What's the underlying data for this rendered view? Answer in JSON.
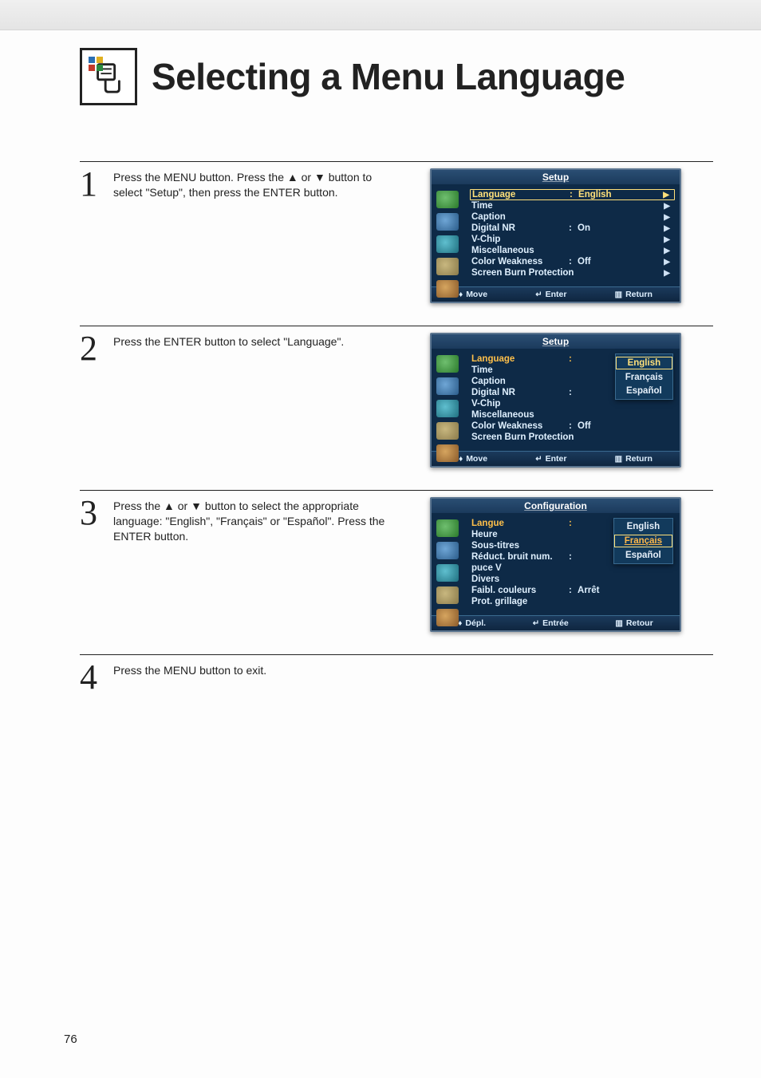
{
  "page_number": "76",
  "title": "Selecting a Menu Language",
  "steps": {
    "s1": {
      "num": "1",
      "text": "Press the MENU button. Press the ▲ or ▼ button to select \"Setup\", then press the ENTER button."
    },
    "s2": {
      "num": "2",
      "text": "Press the ENTER button to select \"Language\"."
    },
    "s3": {
      "num": "3",
      "text": "Press the ▲ or ▼ button to select the appropriate language: \"English\", \"Français\" or \"Español\". Press the ENTER button."
    },
    "s4": {
      "num": "4",
      "text": "Press the MENU button to exit."
    }
  },
  "osd1": {
    "title": "Setup",
    "rows": {
      "language": "Language",
      "language_val": "English",
      "time": "Time",
      "caption": "Caption",
      "digital_nr": "Digital NR",
      "digital_nr_val": "On",
      "vchip": "V-Chip",
      "misc": "Miscellaneous",
      "color_weakness": "Color Weakness",
      "color_weakness_val": "Off",
      "sbp": "Screen Burn Protection"
    },
    "footer": {
      "move": "Move",
      "enter": "Enter",
      "return": "Return"
    }
  },
  "osd2": {
    "title": "Setup",
    "rows": {
      "language": "Language",
      "time": "Time",
      "caption": "Caption",
      "digital_nr": "Digital NR",
      "vchip": "V-Chip",
      "misc": "Miscellaneous",
      "color_weakness": "Color Weakness",
      "color_weakness_val": "Off",
      "sbp": "Screen Burn Protection"
    },
    "options": {
      "o1": "English",
      "o2": "Français",
      "o3": "Español"
    },
    "footer": {
      "move": "Move",
      "enter": "Enter",
      "return": "Return"
    }
  },
  "osd3": {
    "title": "Configuration",
    "rows": {
      "langue": "Langue",
      "heure": "Heure",
      "sous": "Sous-titres",
      "reduct": "Réduct. bruit num.",
      "puce": "puce V",
      "divers": "Divers",
      "faibl": "Faibl. couleurs",
      "faibl_val": "Arrêt",
      "prot": "Prot. grillage"
    },
    "options": {
      "o1": "English",
      "o2": "Français",
      "o3": "Español"
    },
    "footer": {
      "move": "Dépl.",
      "enter": "Entrée",
      "return": "Retour"
    }
  }
}
